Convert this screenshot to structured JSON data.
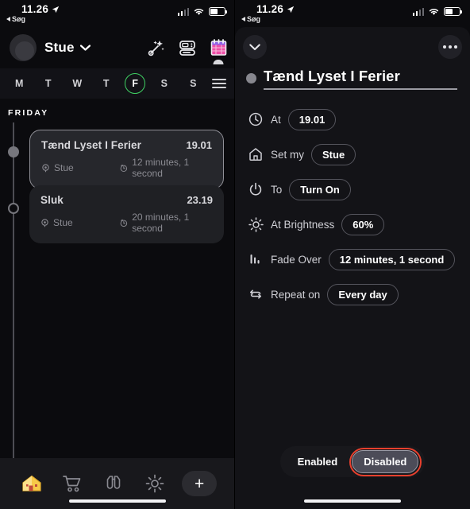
{
  "status_bar": {
    "time": "11.26",
    "back_label": "Søg",
    "location_icon": "location-arrow-icon",
    "signal_icon": "cellular-signal-icon",
    "wifi_icon": "wifi-icon",
    "battery_icon": "battery-icon"
  },
  "left_panel": {
    "header": {
      "avatar": "user-avatar",
      "home_name": "Stue",
      "chevron_icon": "chevron-down-icon",
      "icons": [
        {
          "name": "magic-wand-icon"
        },
        {
          "name": "device-remote-icon"
        },
        {
          "name": "calendar-icon"
        }
      ]
    },
    "day_strip": {
      "days": [
        {
          "label": "M",
          "selected": false
        },
        {
          "label": "T",
          "selected": false
        },
        {
          "label": "W",
          "selected": false
        },
        {
          "label": "T",
          "selected": false
        },
        {
          "label": "F",
          "selected": true
        },
        {
          "label": "S",
          "selected": false
        },
        {
          "label": "S",
          "selected": false
        }
      ],
      "menu_icon": "hamburger-menu-icon",
      "selected_color": "#3fd063"
    },
    "day_label": "FRIDAY",
    "schedule": [
      {
        "title": "Tænd Lyset I Ferier",
        "time": "19.01",
        "room": "Stue",
        "duration": "12 minutes, 1 second",
        "selected": true,
        "marker": "filled",
        "room_icon": "location-pin-icon",
        "duration_icon": "timer-icon"
      },
      {
        "title": "Sluk",
        "time": "23.19",
        "room": "Stue",
        "duration": "20 minutes, 1 second",
        "selected": false,
        "marker": "hollow",
        "room_icon": "location-pin-icon",
        "duration_icon": "timer-icon"
      }
    ],
    "tab_bar": {
      "tabs": [
        {
          "name": "home-tab",
          "icon": "house-icon",
          "active": true
        },
        {
          "name": "shop-tab",
          "icon": "shopping-cart-icon",
          "active": false
        },
        {
          "name": "discover-tab",
          "icon": "binoculars-icon",
          "active": false
        },
        {
          "name": "settings-tab",
          "icon": "gear-icon",
          "active": false
        }
      ],
      "add_label": "+"
    }
  },
  "right_panel": {
    "collapse_icon": "chevron-down-icon",
    "more_icon": "more-horizontal-icon",
    "title": "Tænd Lyset I Ferier",
    "details": [
      {
        "icon": "clock-icon",
        "label": "At",
        "value": "19.01"
      },
      {
        "icon": "home-icon",
        "label": "Set my",
        "value": "Stue"
      },
      {
        "icon": "power-icon",
        "label": "To",
        "value": "Turn On"
      },
      {
        "icon": "brightness-icon",
        "label": "At Brightness",
        "value": "60%"
      },
      {
        "icon": "fade-bars-icon",
        "label": "Fade Over",
        "value": "12 minutes, 1 second"
      },
      {
        "icon": "repeat-icon",
        "label": "Repeat on",
        "value": "Every day"
      }
    ],
    "state_toggle": {
      "options": [
        {
          "label": "Enabled",
          "selected": false
        },
        {
          "label": "Disabled",
          "selected": true
        }
      ],
      "highlight_color": "#e8402e"
    }
  }
}
